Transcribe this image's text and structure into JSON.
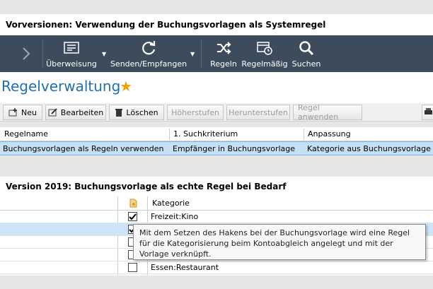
{
  "headings": {
    "top": "Vorversionen: Verwendung der Buchungsvorlagen als Systemregel",
    "middle": "Version 2019: Buchungsvorlage als echte Regel bei Bedarf"
  },
  "toolbar": {
    "transfer": "Überweisung",
    "send_receive": "Senden/Empfangen",
    "rules": "Regeln",
    "recurring": "Regelmäßig",
    "search": "Suchen"
  },
  "page": {
    "title": "Regelverwaltung"
  },
  "commands": {
    "new": "Neu",
    "edit": "Bearbeiten",
    "delete": "Löschen",
    "priority_up": "Höherstufen",
    "priority_down": "Herunterstufen",
    "apply": "Regel anwenden"
  },
  "rules_table": {
    "columns": [
      "Regelname",
      "1. Suchkriterium",
      "Anpassung"
    ],
    "rows": [
      [
        "Buchungsvorlagen als Regeln verwenden",
        "Empfänger in Buchungsvorlage",
        "Kategorie aus Buchungsvorlage"
      ]
    ]
  },
  "template_table": {
    "column_category": "Kategorie",
    "rows": [
      {
        "checked": true,
        "category": "Freizeit:Kino"
      },
      {
        "checked": true,
        "category": ""
      },
      {
        "checked": false,
        "category": ""
      },
      {
        "checked": false,
        "category": ""
      },
      {
        "checked": false,
        "category": "Essen:Restaurant"
      }
    ]
  },
  "tooltip": {
    "text": "Mit dem Setzen des Hakens bei der Buchungsvorlage wird eine Regel für die Kategorisierung beim Kontoabgleich angelegt und mit der Vorlage verknüpft."
  },
  "colors": {
    "toolbar_bg": "#3d4c5c",
    "title_blue": "#1f6fb2",
    "star": "#f2a000",
    "selection": "#c5dff7"
  }
}
